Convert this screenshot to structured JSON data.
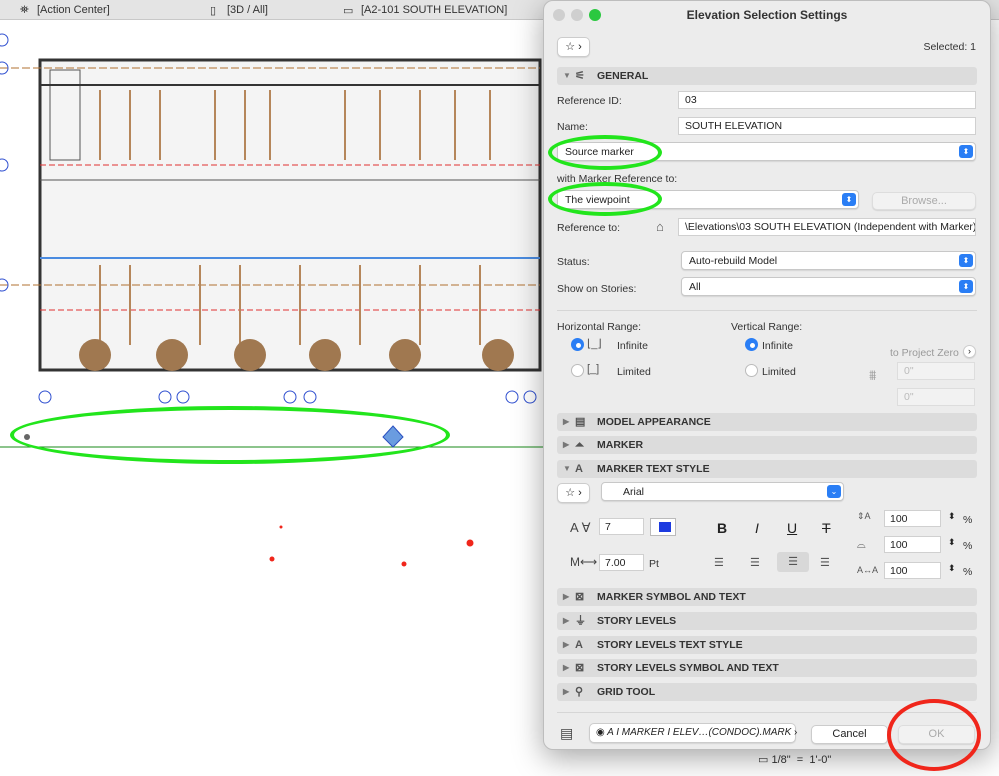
{
  "tabs": [
    {
      "label": "[Action Center]",
      "icon": "lighthouse-icon"
    },
    {
      "label": "[3D / All]",
      "icon": "cube-icon"
    },
    {
      "label": "[A2-101 SOUTH ELEVATION]",
      "icon": "elevation-view-icon"
    }
  ],
  "dialog": {
    "title": "Elevation Selection Settings",
    "selected": "Selected: 1",
    "sections": {
      "general": "GENERAL",
      "model_appearance": "MODEL APPEARANCE",
      "marker": "MARKER",
      "marker_text_style": "MARKER TEXT STYLE",
      "marker_symbol": "MARKER SYMBOL AND TEXT",
      "story_levels": "STORY LEVELS",
      "story_levels_text": "STORY LEVELS TEXT STYLE",
      "story_levels_symbol": "STORY LEVELS SYMBOL AND TEXT",
      "grid_tool": "GRID TOOL"
    },
    "general": {
      "ref_id_label": "Reference ID:",
      "ref_id": "03",
      "name_label": "Name:",
      "name": "SOUTH ELEVATION",
      "marker_type": "Source marker",
      "with_marker_ref_label": "with Marker Reference to:",
      "marker_ref": "The viewpoint",
      "browse": "Browse...",
      "reference_to_label": "Reference to:",
      "reference_to": "\\Elevations\\03 SOUTH ELEVATION (Independent with Marker)",
      "status_label": "Status:",
      "status": "Auto-rebuild Model",
      "stories_label": "Show on Stories:",
      "stories": "All",
      "horizontal_range_label": "Horizontal Range:",
      "vertical_range_label": "Vertical Range:",
      "infinite": "Infinite",
      "limited": "Limited",
      "horizontal_selected": "Infinite",
      "vertical_selected": "Infinite",
      "to_project_zero": "to Project Zero",
      "top_value": "0\"",
      "bottom_value": "0\""
    },
    "text_style": {
      "font": "Arial",
      "size": "7",
      "pen_size": "7.00",
      "unit": "Pt",
      "width_pct": "100",
      "spacing_pct": "100",
      "slant_pct": "100",
      "pct": "%",
      "bold": "B",
      "italic": "I",
      "underline": "U",
      "strike": "T"
    },
    "footer": {
      "layer": "A I MARKER I ELEV…(CONDOC).MARK",
      "cancel": "Cancel",
      "ok": "OK"
    }
  },
  "scale": {
    "left": "1/8\"",
    "eq": "=",
    "right": "1'-0\""
  },
  "annotation_colors": {
    "green": "#22e51c",
    "red": "#f0261b"
  }
}
